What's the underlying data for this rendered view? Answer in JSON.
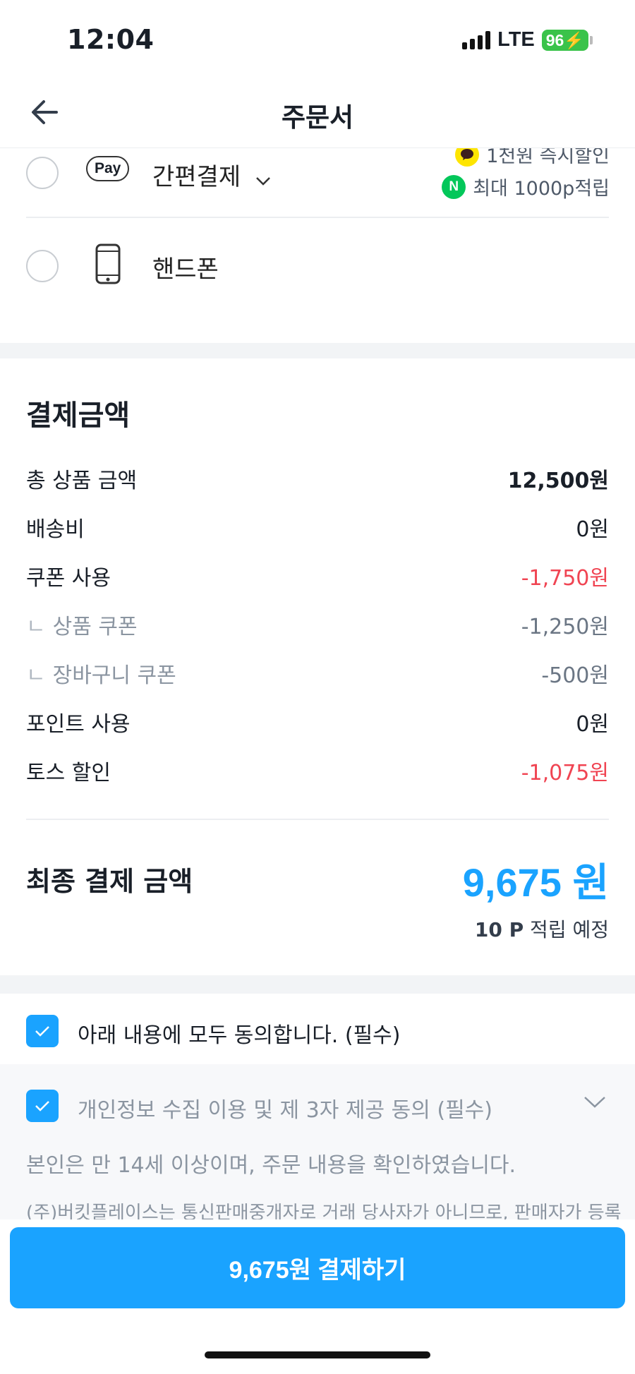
{
  "status": {
    "time": "12:04",
    "network": "LTE",
    "battery": "96"
  },
  "nav": {
    "title": "주문서"
  },
  "payment_methods": [
    {
      "badge": "Pay",
      "label": "간편결제",
      "promos": [
        {
          "icon": "kakao-talk-icon",
          "text": "1천원 즉시할인"
        },
        {
          "icon": "naver-n-icon",
          "icon_text": "N",
          "text": "최대 1000p적립"
        }
      ]
    },
    {
      "label": "핸드폰"
    }
  ],
  "summary": {
    "title": "결제금액",
    "rows": [
      {
        "label": "총 상품 금액",
        "value": "12,500원"
      },
      {
        "label": "배송비",
        "value": "0원"
      },
      {
        "label": "쿠폰 사용",
        "value": "-1,750원"
      },
      {
        "label": "상품 쿠폰",
        "value": "-1,250원"
      },
      {
        "label": "장바구니 쿠폰",
        "value": "-500원"
      },
      {
        "label": "포인트 사용",
        "value": "0원"
      },
      {
        "label": "토스 할인",
        "value": "-1,075원"
      }
    ],
    "sub_mark": "ㄴ",
    "final_label": "최종 결제 금액",
    "final_value": "9,675 원",
    "points_bold": "10 P",
    "points_rest": " 적립 예정"
  },
  "agreement": {
    "all_label": "아래 내용에 모두 동의합니다. (필수)",
    "privacy_label": "개인정보 수집 이용 및 제 3자 제공 동의 (필수)",
    "age_text": "본인은 만 14세 이상이며, 주문 내용을 확인하였습니다.",
    "notice_text": "(주)버킷플레이스는 통신판매중개자로 거래 당사자가 아니므로, 판매자가 등록"
  },
  "cta": {
    "label": "9,675원 결제하기"
  },
  "colors": {
    "accent": "#1aa3ff",
    "discount": "#f04452",
    "kakao": "#fee500",
    "naver": "#03c75a"
  }
}
